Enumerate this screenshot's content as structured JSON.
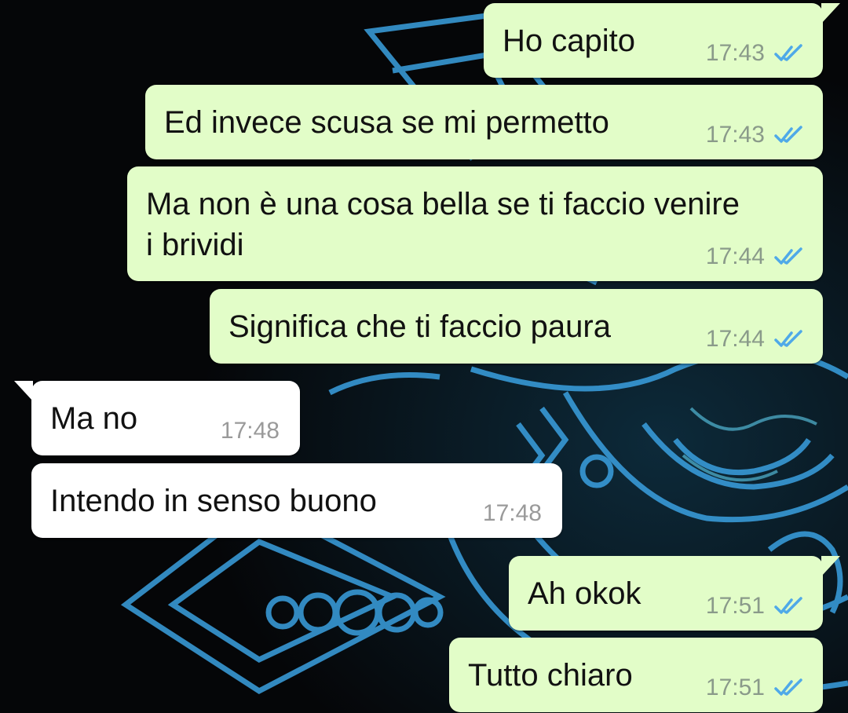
{
  "messages": [
    {
      "direction": "out",
      "text": "Ho capito",
      "time": "17:43",
      "status_icon": "double-check-read-icon"
    },
    {
      "direction": "out",
      "text": "Ed invece scusa se mi permetto",
      "time": "17:43",
      "status_icon": "double-check-read-icon"
    },
    {
      "direction": "out",
      "text": "Ma non è una cosa bella se ti faccio venire\ni brividi",
      "time": "17:44",
      "status_icon": "double-check-read-icon"
    },
    {
      "direction": "out",
      "text": "Significa che ti faccio paura",
      "time": "17:44",
      "status_icon": "double-check-read-icon"
    },
    {
      "direction": "in",
      "text": "Ma no",
      "time": "17:48"
    },
    {
      "direction": "in",
      "text": "Intendo in senso buono",
      "time": "17:48"
    },
    {
      "direction": "out",
      "text": "Ah okok",
      "time": "17:51",
      "status_icon": "double-check-read-icon"
    },
    {
      "direction": "out",
      "text": "Tutto chiaro",
      "time": "17:51",
      "status_icon": "double-check-read-icon"
    }
  ],
  "colors": {
    "outgoing_bubble": "#e2fdc8",
    "incoming_bubble": "#ffffff",
    "read_ticks": "#4fa9e8",
    "wallpaper_bg": "#050608",
    "wallpaper_lines": "#3b8fd8"
  }
}
